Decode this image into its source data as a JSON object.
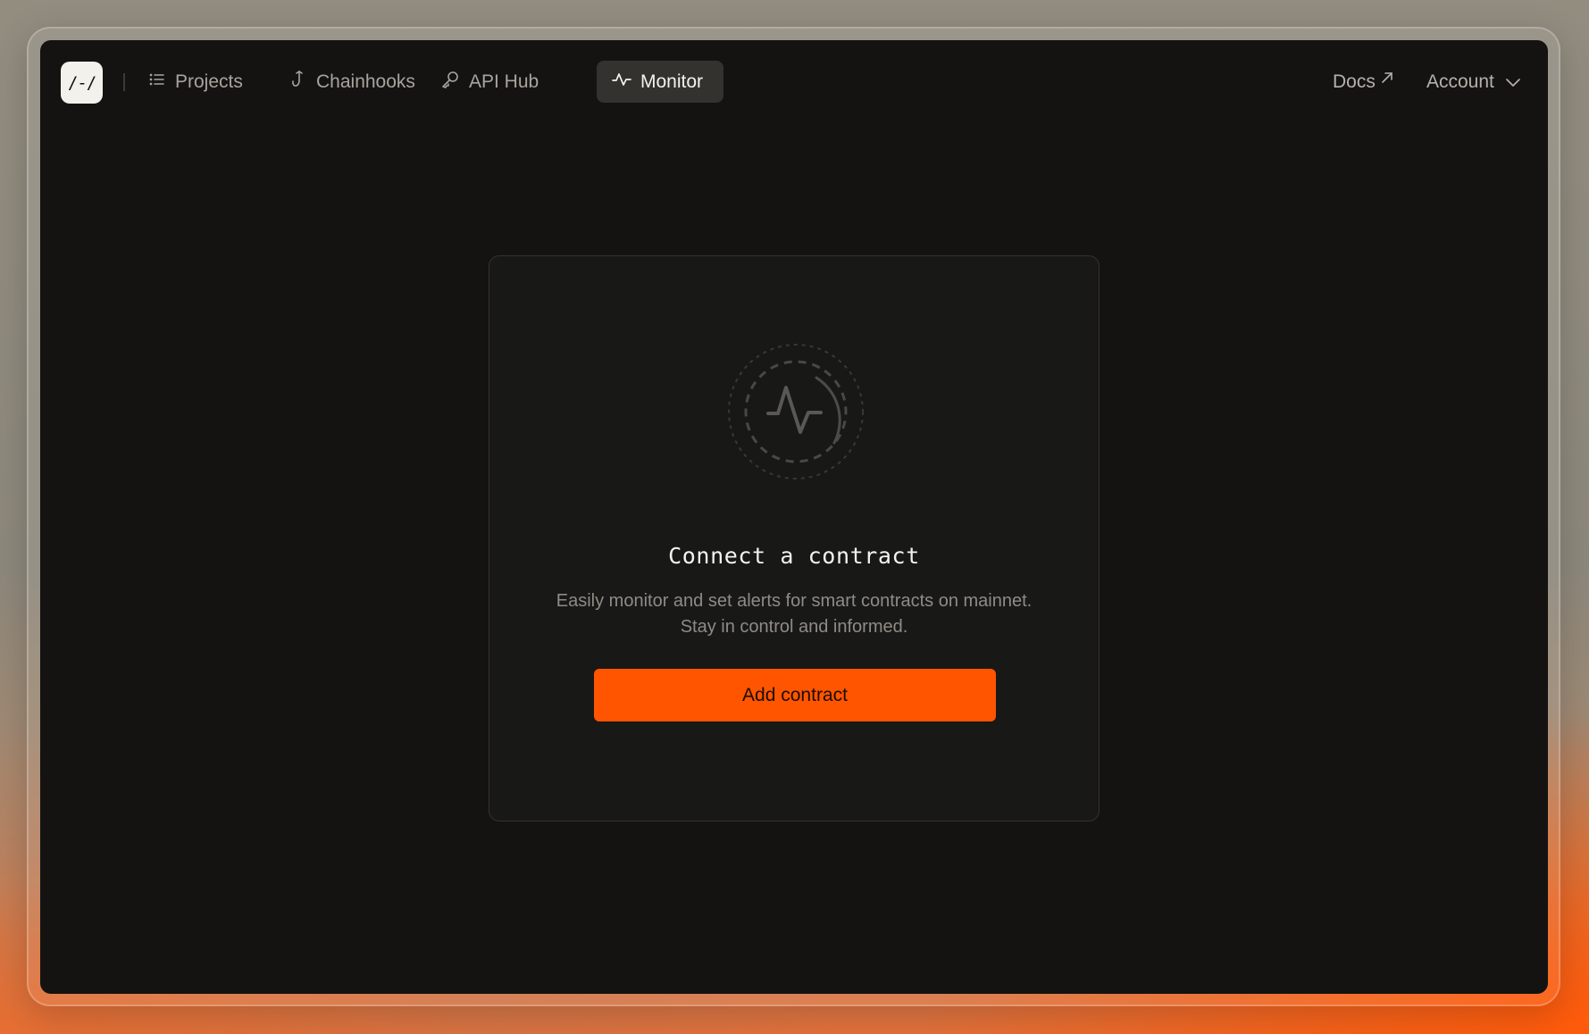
{
  "logo": {
    "text": "/-/"
  },
  "nav": {
    "items": [
      {
        "label": "Projects",
        "icon": "list-icon"
      },
      {
        "label": "Chainhooks",
        "icon": "hook-icon"
      },
      {
        "label": "API Hub",
        "icon": "key-icon"
      },
      {
        "label": "Monitor",
        "icon": "pulse-icon",
        "active": true
      }
    ],
    "docs_label": "Docs",
    "account_label": "Account"
  },
  "empty_state": {
    "title": "Connect a contract",
    "description_line1": "Easily monitor and set alerts for smart contracts on mainnet.",
    "description_line2": "Stay in control and informed.",
    "button_label": "Add contract"
  },
  "colors": {
    "accent": "#ff5500",
    "screen_bg": "#141312",
    "card_bg": "#181817",
    "active_tab_bg": "#34322f"
  }
}
